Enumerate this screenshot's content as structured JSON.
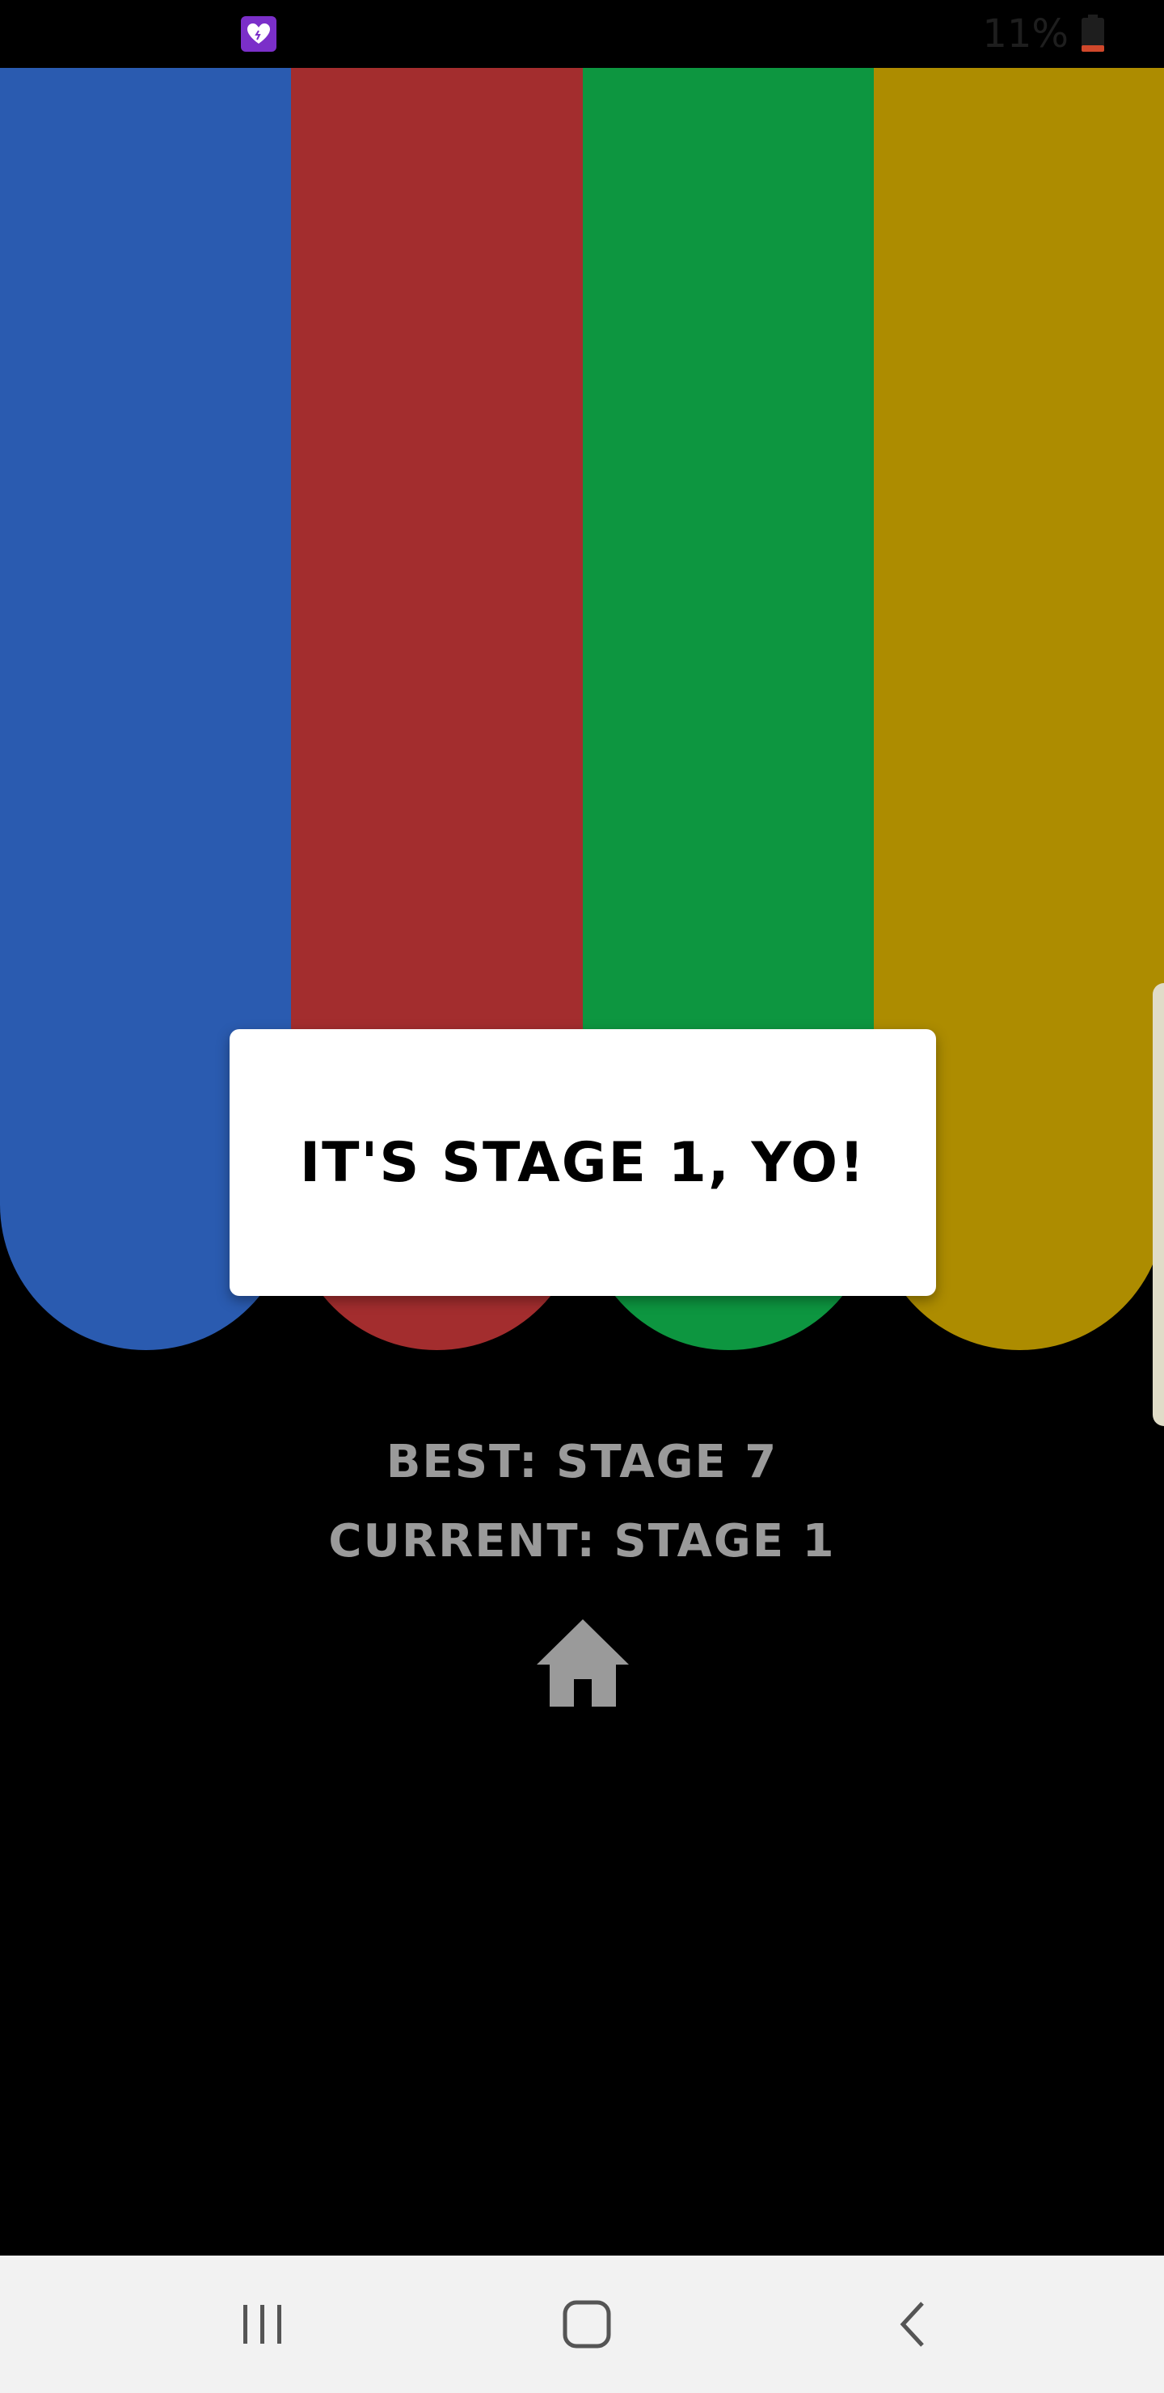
{
  "status_bar": {
    "battery_text": "11%",
    "app_icon": "heart-app-icon",
    "battery_icon": "battery-low-icon"
  },
  "pads": [
    {
      "name": "blue",
      "color": "#2a5bb0"
    },
    {
      "name": "red",
      "color": "#a32d2e"
    },
    {
      "name": "green",
      "color": "#0d9640"
    },
    {
      "name": "yellow",
      "color": "#ad8c00"
    }
  ],
  "dialog": {
    "message": "IT'S STAGE 1, YO!"
  },
  "scores": {
    "best": "BEST: STAGE 7",
    "current": "CURRENT: STAGE 1"
  },
  "home_button": {
    "icon": "home-icon"
  },
  "nav_bar": {
    "recents_icon": "recents-icon",
    "home_icon": "home-square-icon",
    "back_icon": "back-chevron-icon"
  }
}
